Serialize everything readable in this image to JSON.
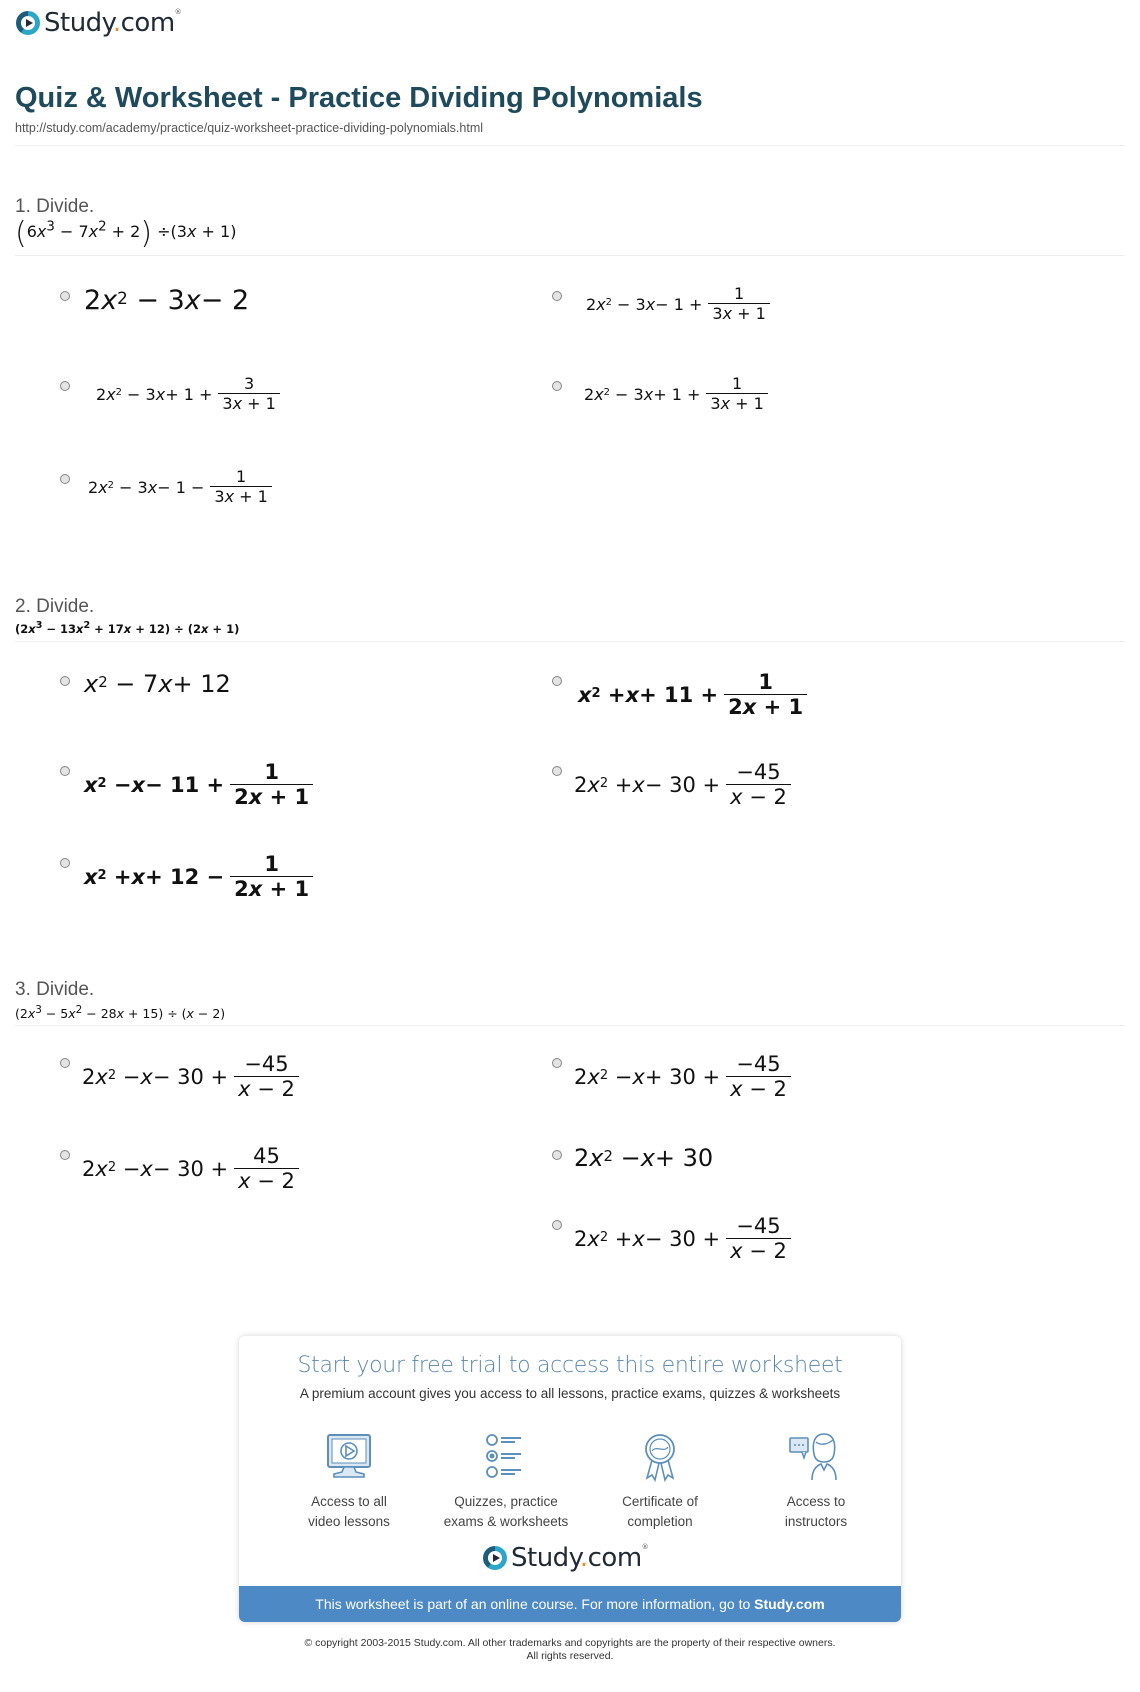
{
  "brand": {
    "name": "Study",
    "dot": ".",
    "tld": "com",
    "tm": "®",
    "accent": "#f08a24",
    "primary": "#1e4a5c",
    "bar_color": "#4d89c4"
  },
  "header": {
    "title": "Quiz & Worksheet - Practice Dividing Polynomials",
    "url": "http://study.com/academy/practice/quiz-worksheet-practice-dividing-polynomials.html"
  },
  "questions": [
    {
      "label": "1. Divide.",
      "expression": "(6x³ − 7x² + 2) ÷(3x + 1)",
      "options": [
        {
          "text": "2x² − 3x − 2"
        },
        {
          "text": "2x² − 3x − 1 + 1/(3x + 1)"
        },
        {
          "text": "2x² − 3x + 1 + 3/(3x + 1)"
        },
        {
          "text": "2x² − 3x + 1 + 1/(3x + 1)"
        },
        {
          "text": "2x² − 3x − 1 − 1/(3x + 1)"
        }
      ]
    },
    {
      "label": "2. Divide.",
      "expression": "(2x³ − 13x² + 17x + 12) ÷ (2x + 1)",
      "options": [
        {
          "text": "x² − 7x + 12"
        },
        {
          "text": "x² + x + 11 + 1/(2x + 1)"
        },
        {
          "text": "x² − x − 11 + 1/(2x + 1)"
        },
        {
          "text": "2x² + x − 30 + −45/(x − 2)"
        },
        {
          "text": "x² + x + 12 − 1/(2x + 1)"
        }
      ]
    },
    {
      "label": "3. Divide.",
      "expression": "(2x³ − 5x² − 28x + 15) ÷ (x − 2)",
      "options": [
        {
          "text": "2x² − x − 30 + −45/(x − 2)"
        },
        {
          "text": "2x² − x + 30 + −45/(x − 2)"
        },
        {
          "text": "2x² − x − 30 + 45/(x − 2)"
        },
        {
          "text": "2x² − x + 30"
        },
        {
          "text": "2x² + x − 30 + −45/(x − 2)"
        }
      ]
    }
  ],
  "promo": {
    "title": "Start your free trial to access this entire worksheet",
    "subtitle": "A premium account gives you access to all lessons, practice exams, quizzes & worksheets",
    "features": [
      {
        "icon": "video-monitor-icon",
        "line1": "Access to all",
        "line2": "video lessons"
      },
      {
        "icon": "quiz-list-icon",
        "line1": "Quizzes, practice",
        "line2": "exams & worksheets"
      },
      {
        "icon": "certificate-ribbon-icon",
        "line1": "Certificate of",
        "line2": "completion"
      },
      {
        "icon": "instructor-chat-icon",
        "line1": "Access to",
        "line2": "instructors"
      }
    ],
    "bar_text": "This worksheet is part of an online course. For more information, go to ",
    "bar_link": "Study.com"
  },
  "footer": {
    "line1": "© copyright 2003-2015 Study.com. All other trademarks and copyrights are the property of their respective owners.",
    "line2": "All rights reserved."
  }
}
